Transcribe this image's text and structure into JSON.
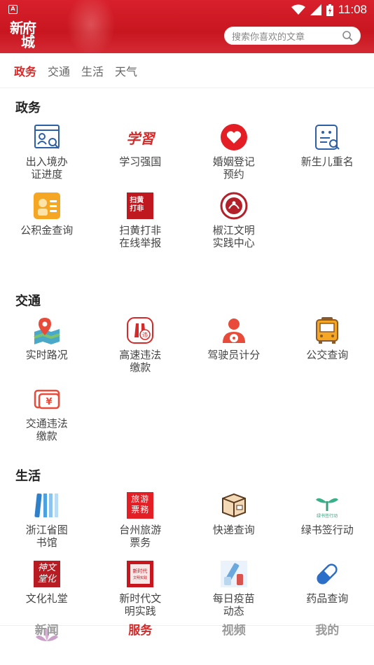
{
  "status_bar": {
    "time": "11:08"
  },
  "header": {
    "logo_line1": "新府",
    "logo_line2": "城",
    "search_placeholder": "搜索你喜欢的文章"
  },
  "tabs": [
    {
      "label": "政务",
      "active": true
    },
    {
      "label": "交通",
      "active": false
    },
    {
      "label": "生活",
      "active": false
    },
    {
      "label": "天气",
      "active": false
    }
  ],
  "sections": [
    {
      "title": "政务",
      "items": [
        {
          "label": "出入境办\n证进度",
          "icon": "document-search-icon"
        },
        {
          "label": "学习强国",
          "icon": "xuexi-logo-icon"
        },
        {
          "label": "婚姻登记\n预约",
          "icon": "heart-icon"
        },
        {
          "label": "新生儿重名",
          "icon": "name-search-icon"
        },
        {
          "label": "公积金查询",
          "icon": "fund-icon"
        },
        {
          "label": "扫黄打非\n在线举报",
          "icon": "report-icon"
        },
        {
          "label": "椒江文明\n实践中心",
          "icon": "civilization-logo-icon"
        }
      ]
    },
    {
      "title": "交通",
      "items": [
        {
          "label": "实时路况",
          "icon": "map-pin-icon"
        },
        {
          "label": "高速违法\n缴款",
          "icon": "highway-icon"
        },
        {
          "label": "驾驶员计分",
          "icon": "driver-icon"
        },
        {
          "label": "公交查询",
          "icon": "bus-icon"
        },
        {
          "label": "交通违法\n缴款",
          "icon": "payment-icon"
        }
      ]
    },
    {
      "title": "生活",
      "items": [
        {
          "label": "浙江省图\n书馆",
          "icon": "library-icon"
        },
        {
          "label": "台州旅游\n票务",
          "icon": "travel-ticket-icon"
        },
        {
          "label": "快递查询",
          "icon": "package-icon"
        },
        {
          "label": "绿书签行动",
          "icon": "green-bookmark-icon"
        },
        {
          "label": "文化礼堂",
          "icon": "culture-hall-icon"
        },
        {
          "label": "新时代文\n明实践",
          "icon": "new-era-icon"
        },
        {
          "label": "每日疫苗\n动态",
          "icon": "vaccine-icon"
        },
        {
          "label": "药品查询",
          "icon": "pill-icon"
        }
      ]
    }
  ],
  "bottom_nav": [
    {
      "label": "新闻",
      "active": false
    },
    {
      "label": "服务",
      "active": true
    },
    {
      "label": "视频",
      "active": false
    },
    {
      "label": "我的",
      "active": false
    }
  ],
  "colors": {
    "brand_red": "#d42a2a",
    "header_red": "#c8161f"
  }
}
